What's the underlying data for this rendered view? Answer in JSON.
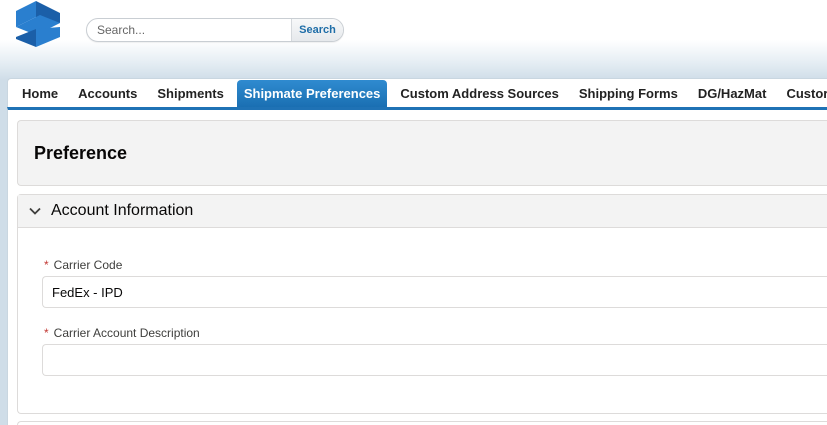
{
  "header": {
    "logo_icon": "brand-logo-icon",
    "search": {
      "placeholder": "Search...",
      "value": "",
      "button_label": "Search"
    }
  },
  "tabs": [
    {
      "label": "Home",
      "active": false
    },
    {
      "label": "Accounts",
      "active": false
    },
    {
      "label": "Shipments",
      "active": false
    },
    {
      "label": "Shipmate Preferences",
      "active": true
    },
    {
      "label": "Custom Address Sources",
      "active": false
    },
    {
      "label": "Shipping Forms",
      "active": false
    },
    {
      "label": "DG/HazMat",
      "active": false
    },
    {
      "label": "Custor",
      "active": false
    }
  ],
  "page": {
    "title": "Preference",
    "section": {
      "title": "Account Information",
      "icon": "chevron-down-icon",
      "fields": [
        {
          "label": "Carrier Code",
          "required_mark": "*",
          "value": "FedEx - IPD"
        },
        {
          "label": "Carrier Account Description",
          "required_mark": "*",
          "value": ""
        }
      ]
    }
  },
  "colors": {
    "active_tab": "#1f72b5",
    "brand_blue": "#1f76c2",
    "required": "#c23934",
    "search_button_text": "#1f6ea8"
  }
}
